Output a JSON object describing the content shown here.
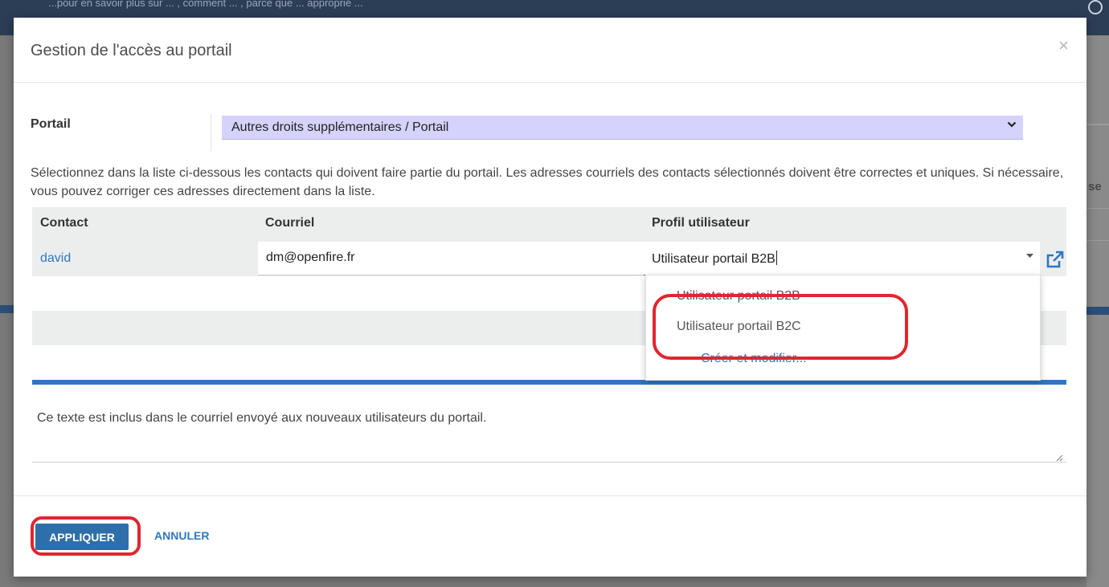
{
  "background": {
    "faint_text": "...pour en savoir plus sur ... , comment ... , parce que ... approprié ...",
    "right_edge_text": "se"
  },
  "modal": {
    "title": "Gestion de l'accès au portail",
    "close_symbol": "×",
    "portal": {
      "label": "Portail",
      "selected_value": "Autres droits supplémentaires / Portail",
      "caret": "⌄"
    },
    "help_text": "Sélectionnez dans la liste ci-dessous les contacts qui doivent faire partie du portail. Les adresses courriels des contacts sélectionnés doivent être correctes et uniques. Si nécessaire, vous pouvez corriger ces adresses directement dans la liste.",
    "table": {
      "headers": {
        "contact": "Contact",
        "email": "Courriel",
        "profile": "Profil utilisateur"
      },
      "rows": [
        {
          "contact": "david",
          "email": "dm@openfire.fr",
          "profile": "Utilisateur portail B2B"
        }
      ]
    },
    "profile_dropdown": {
      "options": [
        "Utilisateur portail B2B",
        "Utilisateur portail B2C"
      ],
      "create_label": "Créer et modifier..."
    },
    "note_text": "Ce texte est inclus dans le courriel envoyé aux nouveaux utilisateurs du portail.",
    "footer": {
      "apply_label": "APPLIQUER",
      "cancel_label": "ANNULER"
    }
  },
  "colors": {
    "primary": "#2f77bf",
    "highlight_annotation": "#e0262f",
    "portal_select_bg": "#d5d2fb"
  }
}
